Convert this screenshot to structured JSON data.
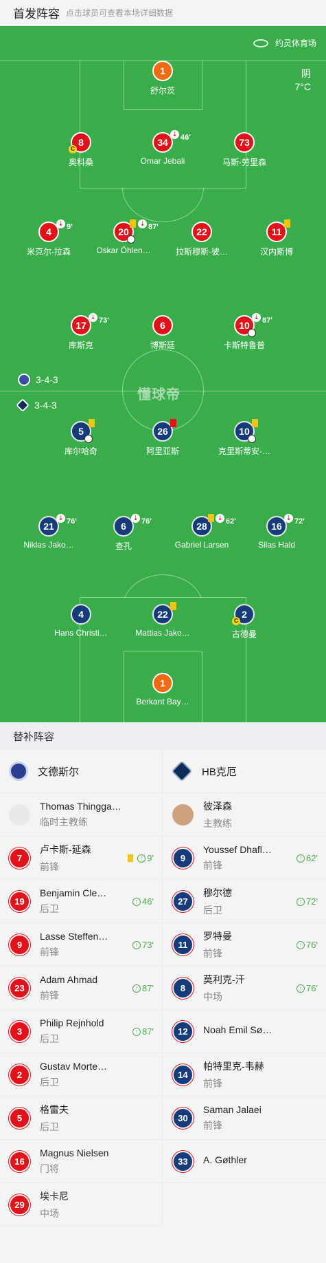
{
  "header": {
    "title": "首发阵容",
    "subtitle": "点击球员可查看本场详细数据"
  },
  "pitch": {
    "stadium": "约灵体育场",
    "weather": "阴",
    "temperature": "7°C",
    "home_formation": "3-4-3",
    "away_formation": "3-4-3",
    "watermark": "懂球帝"
  },
  "home_players": [
    {
      "num": "1",
      "name": "舒尔茨"
    },
    {
      "num": "8",
      "name": "奥科桑"
    },
    {
      "num": "34",
      "name": "Omar Jebali",
      "sub_time": "46'"
    },
    {
      "num": "73",
      "name": "马斯-劳里森"
    },
    {
      "num": "4",
      "name": "米克尔-拉森",
      "sub_time": "9'"
    },
    {
      "num": "20",
      "name": "Oskar Öhlen…",
      "sub_time": "87'"
    },
    {
      "num": "22",
      "name": "拉斯穆斯-彼…"
    },
    {
      "num": "11",
      "name": "汉内斯博"
    },
    {
      "num": "17",
      "name": "库斯克",
      "sub_time": "73'"
    },
    {
      "num": "6",
      "name": "博斯廷"
    },
    {
      "num": "10",
      "name": "卡斯特鲁普",
      "sub_time": "87'"
    }
  ],
  "away_players": [
    {
      "num": "5",
      "name": "库尔哈奇"
    },
    {
      "num": "26",
      "name": "阿里亚斯"
    },
    {
      "num": "10",
      "name": "克里斯蒂安-…"
    },
    {
      "num": "21",
      "name": "Niklas Jako…",
      "sub_time": "76'"
    },
    {
      "num": "6",
      "name": "查孔",
      "sub_time": "76'"
    },
    {
      "num": "28",
      "name": "Gabriel Larsen",
      "sub_time": "62'"
    },
    {
      "num": "16",
      "name": "Silas Hald",
      "sub_time": "72'"
    },
    {
      "num": "4",
      "name": "Hans Christi…"
    },
    {
      "num": "22",
      "name": "Mattias Jako…"
    },
    {
      "num": "2",
      "name": "古德曼"
    },
    {
      "num": "1",
      "name": "Berkant Bay…"
    }
  ],
  "bench": {
    "title": "替补阵容",
    "home_team": "文德斯尔",
    "away_team": "HB克厄",
    "home_coach": {
      "name": "Thomas Thinggaard",
      "role": "临时主教练"
    },
    "away_coach": {
      "name": "彼泽森",
      "role": "主教练"
    },
    "home_subs": [
      {
        "num": "7",
        "name": "卢卡斯-延森",
        "pos": "前锋",
        "time": "9'"
      },
      {
        "num": "19",
        "name": "Benjamin Cle…",
        "pos": "后卫",
        "time": "46'"
      },
      {
        "num": "9",
        "name": "Lasse Steffen…",
        "pos": "前锋",
        "time": "73'"
      },
      {
        "num": "23",
        "name": "Adam Ahmad",
        "pos": "前锋",
        "time": "87'"
      },
      {
        "num": "3",
        "name": "Philip Rejnhold",
        "pos": "后卫",
        "time": "87'"
      },
      {
        "num": "2",
        "name": "Gustav Morte…",
        "pos": "后卫",
        "time": ""
      },
      {
        "num": "5",
        "name": "格雷夫",
        "pos": "后卫",
        "time": ""
      },
      {
        "num": "16",
        "name": "Magnus Nielsen",
        "pos": "门将",
        "time": ""
      },
      {
        "num": "29",
        "name": "埃卡尼",
        "pos": "中场",
        "time": ""
      }
    ],
    "away_subs": [
      {
        "num": "9",
        "name": "Youssef Dhafl…",
        "pos": "前锋",
        "time": "62'"
      },
      {
        "num": "27",
        "name": "穆尔德",
        "pos": "后卫",
        "time": "72'"
      },
      {
        "num": "11",
        "name": "罗特曼",
        "pos": "前锋",
        "time": "76'"
      },
      {
        "num": "8",
        "name": "莫利克-汗",
        "pos": "中场",
        "time": "76'"
      },
      {
        "num": "12",
        "name": "Noah Emil Sø…",
        "pos": "",
        "time": ""
      },
      {
        "num": "14",
        "name": "帕特里克-韦赫",
        "pos": "前锋",
        "time": ""
      },
      {
        "num": "30",
        "name": "Saman Jalaei",
        "pos": "前锋",
        "time": ""
      },
      {
        "num": "33",
        "name": "A. Gøthler",
        "pos": "",
        "time": ""
      }
    ]
  },
  "colors": {
    "pitch": "#3aad4b",
    "home": "#e4111a",
    "away": "#153b7a",
    "goalkeeper": "#f26b12"
  }
}
